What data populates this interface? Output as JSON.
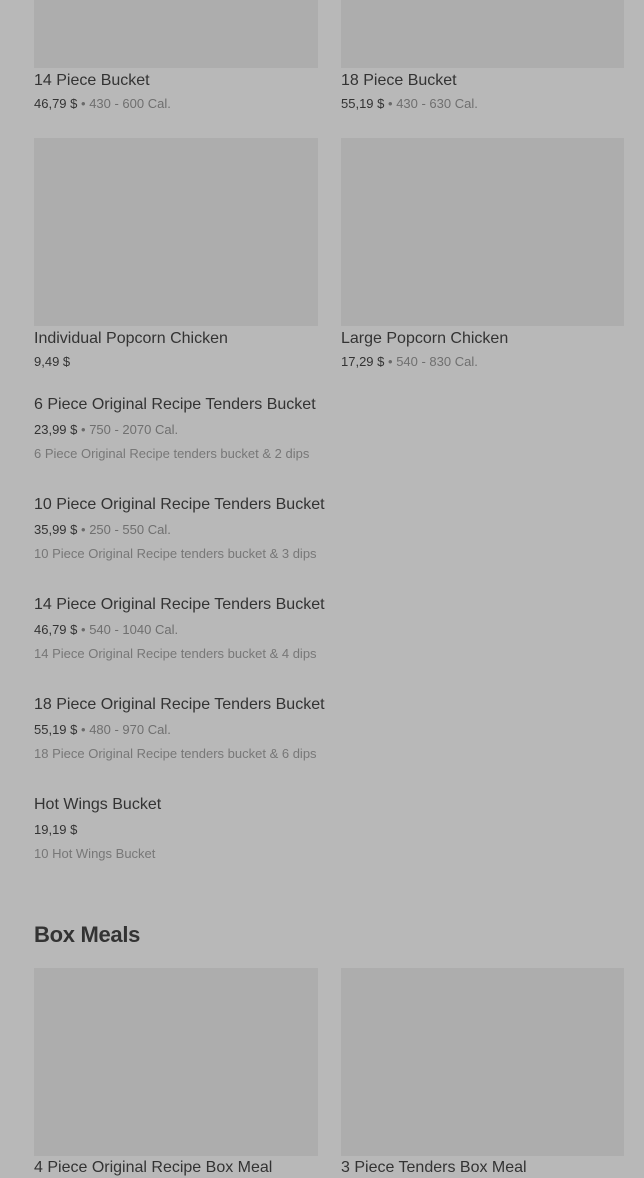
{
  "grid_top": [
    {
      "title": "14 Piece Bucket",
      "price": "46,79 $",
      "sep": "•",
      "calories": "430 - 600 Cal."
    },
    {
      "title": "18 Piece Bucket",
      "price": "55,19 $",
      "sep": "•",
      "calories": "430 - 630 Cal."
    },
    {
      "title": "Individual Popcorn Chicken",
      "price": "9,49 $"
    },
    {
      "title": "Large Popcorn Chicken",
      "price": "17,29 $",
      "sep": "•",
      "calories": "540 - 830 Cal."
    }
  ],
  "list": [
    {
      "title": "6 Piece Original Recipe Tenders Bucket",
      "price": "23,99 $",
      "sep": "•",
      "calories": "750 - 2070 Cal.",
      "desc": "6 Piece Original Recipe tenders bucket & 2 dips"
    },
    {
      "title": "10 Piece Original Recipe Tenders Bucket",
      "price": "35,99 $",
      "sep": "•",
      "calories": "250 - 550 Cal.",
      "desc": "10 Piece Original Recipe tenders bucket & 3 dips"
    },
    {
      "title": "14 Piece Original Recipe Tenders Bucket",
      "price": "46,79 $",
      "sep": "•",
      "calories": "540 - 1040 Cal.",
      "desc": "14 Piece Original Recipe tenders bucket & 4 dips"
    },
    {
      "title": "18 Piece Original Recipe Tenders Bucket",
      "price": "55,19 $",
      "sep": "•",
      "calories": "480 - 970 Cal.",
      "desc": "18 Piece Original Recipe tenders bucket & 6 dips"
    },
    {
      "title": "Hot Wings Bucket",
      "price": "19,19 $",
      "desc": "10 Hot Wings Bucket"
    }
  ],
  "box_meals": {
    "heading": "Box Meals",
    "items": [
      {
        "title": "4 Piece Original Recipe Box Meal"
      },
      {
        "title": "3 Piece Tenders Box Meal"
      }
    ]
  }
}
